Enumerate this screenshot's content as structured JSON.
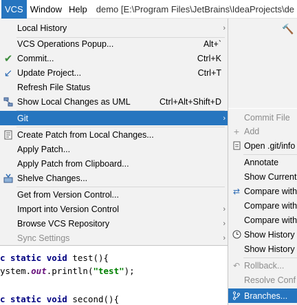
{
  "menubar": {
    "vcs": "VCS",
    "window": "Window",
    "help": "Help",
    "title": "demo [E:\\Program Files\\JetBrains\\IdeaProjects\\de"
  },
  "vcs_menu": {
    "local_history": "Local History",
    "ops_popup": "VCS Operations Popup...",
    "ops_popup_sc": "Alt+`",
    "commit": "Commit...",
    "commit_sc": "Ctrl+K",
    "update": "Update Project...",
    "update_sc": "Ctrl+T",
    "refresh": "Refresh File Status",
    "show_uml": "Show Local Changes as UML",
    "show_uml_sc": "Ctrl+Alt+Shift+D",
    "git": "Git",
    "create_patch": "Create Patch from Local Changes...",
    "apply_patch": "Apply Patch...",
    "apply_patch_clip": "Apply Patch from Clipboard...",
    "shelve": "Shelve Changes...",
    "get_from_vc": "Get from Version Control...",
    "import_vc": "Import into Version Control",
    "browse_repo": "Browse VCS Repository",
    "sync": "Sync Settings"
  },
  "git_menu": {
    "commit_file": "Commit File",
    "add": "Add",
    "open_gitinfo": "Open .git/info",
    "annotate": "Annotate",
    "show_current": "Show Current",
    "compare_with_1": "Compare with",
    "compare_with_2": "Compare with",
    "compare_with_3": "Compare with",
    "show_history_1": "Show History",
    "show_history_2": "Show History",
    "rollback": "Rollback...",
    "resolve": "Resolve Conf",
    "branches": "Branches..."
  },
  "editor": {
    "l1_kw": "c static void",
    "l1_rest": " test(){",
    "l2_pre": "ystem.",
    "l2_out": "out",
    "l2_mid": ".println(",
    "l2_str": "\"test\"",
    "l2_end": ");",
    "l3_kw": "c static void",
    "l3_rest": " second(){"
  },
  "colors": {
    "selection": "#2675bf",
    "menu_bg": "#f2f2f2",
    "disabled": "#8c8c8c"
  }
}
